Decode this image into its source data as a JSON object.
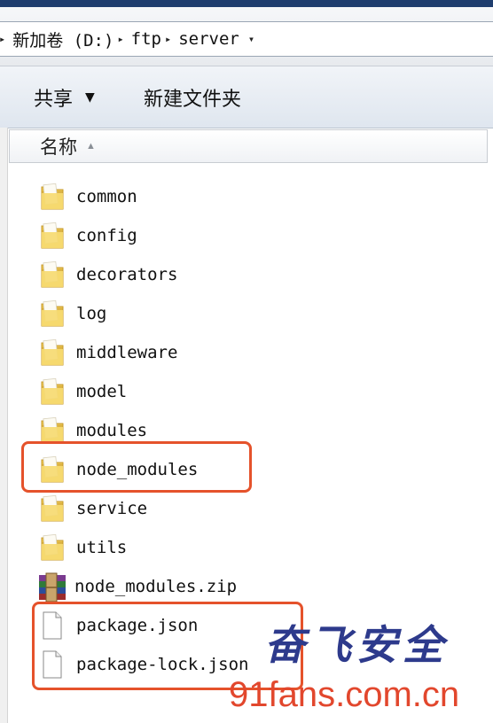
{
  "address": {
    "crumbs": [
      "新加卷 (D:)",
      "ftp",
      "server"
    ]
  },
  "toolbar": {
    "share_label": "共享",
    "new_folder_label": "新建文件夹"
  },
  "columns": {
    "name_label": "名称"
  },
  "files": [
    {
      "name": "common",
      "type": "folder"
    },
    {
      "name": "config",
      "type": "folder"
    },
    {
      "name": "decorators",
      "type": "folder"
    },
    {
      "name": "log",
      "type": "folder"
    },
    {
      "name": "middleware",
      "type": "folder"
    },
    {
      "name": "model",
      "type": "folder"
    },
    {
      "name": "modules",
      "type": "folder"
    },
    {
      "name": "node_modules",
      "type": "folder"
    },
    {
      "name": "service",
      "type": "folder"
    },
    {
      "name": "utils",
      "type": "folder"
    },
    {
      "name": "node_modules.zip",
      "type": "archive"
    },
    {
      "name": "package.json",
      "type": "file"
    },
    {
      "name": "package-lock.json",
      "type": "file"
    }
  ],
  "watermark": {
    "chinese": "奋飞安全",
    "url": "91fans.com.cn"
  },
  "colors": {
    "highlight": "#e5522b",
    "folder": "#f4d46a",
    "watermark_cn": "#2d3a8c",
    "watermark_url": "#e2472d"
  }
}
